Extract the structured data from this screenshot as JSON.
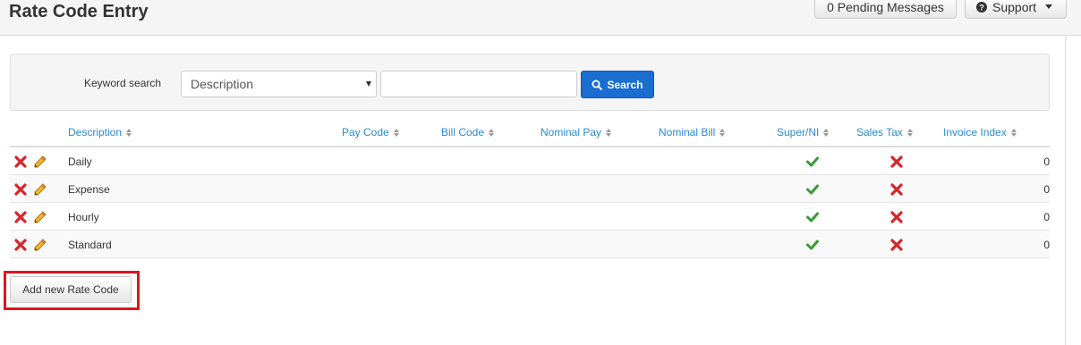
{
  "header": {
    "title": "Rate Code Entry",
    "pending_messages": "0 Pending Messages",
    "support": "Support"
  },
  "search": {
    "label": "Keyword search",
    "field_selected": "Description",
    "query": "",
    "button": "Search"
  },
  "table": {
    "columns": [
      "Description",
      "Pay Code",
      "Bill Code",
      "Nominal Pay",
      "Nominal Bill",
      "Super/NI",
      "Sales Tax",
      "Invoice Index"
    ],
    "rows": [
      {
        "description": "Daily",
        "pay_code": "",
        "bill_code": "",
        "nominal_pay": "",
        "nominal_bill": "",
        "super_ni": true,
        "sales_tax": false,
        "invoice_index": "0"
      },
      {
        "description": "Expense",
        "pay_code": "",
        "bill_code": "",
        "nominal_pay": "",
        "nominal_bill": "",
        "super_ni": true,
        "sales_tax": false,
        "invoice_index": "0"
      },
      {
        "description": "Hourly",
        "pay_code": "",
        "bill_code": "",
        "nominal_pay": "",
        "nominal_bill": "",
        "super_ni": true,
        "sales_tax": false,
        "invoice_index": "0"
      },
      {
        "description": "Standard",
        "pay_code": "",
        "bill_code": "",
        "nominal_pay": "",
        "nominal_bill": "",
        "super_ni": true,
        "sales_tax": false,
        "invoice_index": "0"
      }
    ]
  },
  "actions": {
    "add_new": "Add new Rate Code"
  },
  "icons": {
    "delete": "delete-x-icon",
    "edit": "pencil-icon",
    "yes": "green-check-icon",
    "no": "red-x-icon",
    "search": "search-icon",
    "help": "question-circle-icon",
    "dropdown": "caret-down-icon",
    "sort": "sort-icon"
  },
  "colors": {
    "link": "#2a8bd0",
    "primary_button": "#1a6ed1",
    "check": "#3a9b3a",
    "cross": "#d9242a",
    "highlight": "#e0151f"
  }
}
